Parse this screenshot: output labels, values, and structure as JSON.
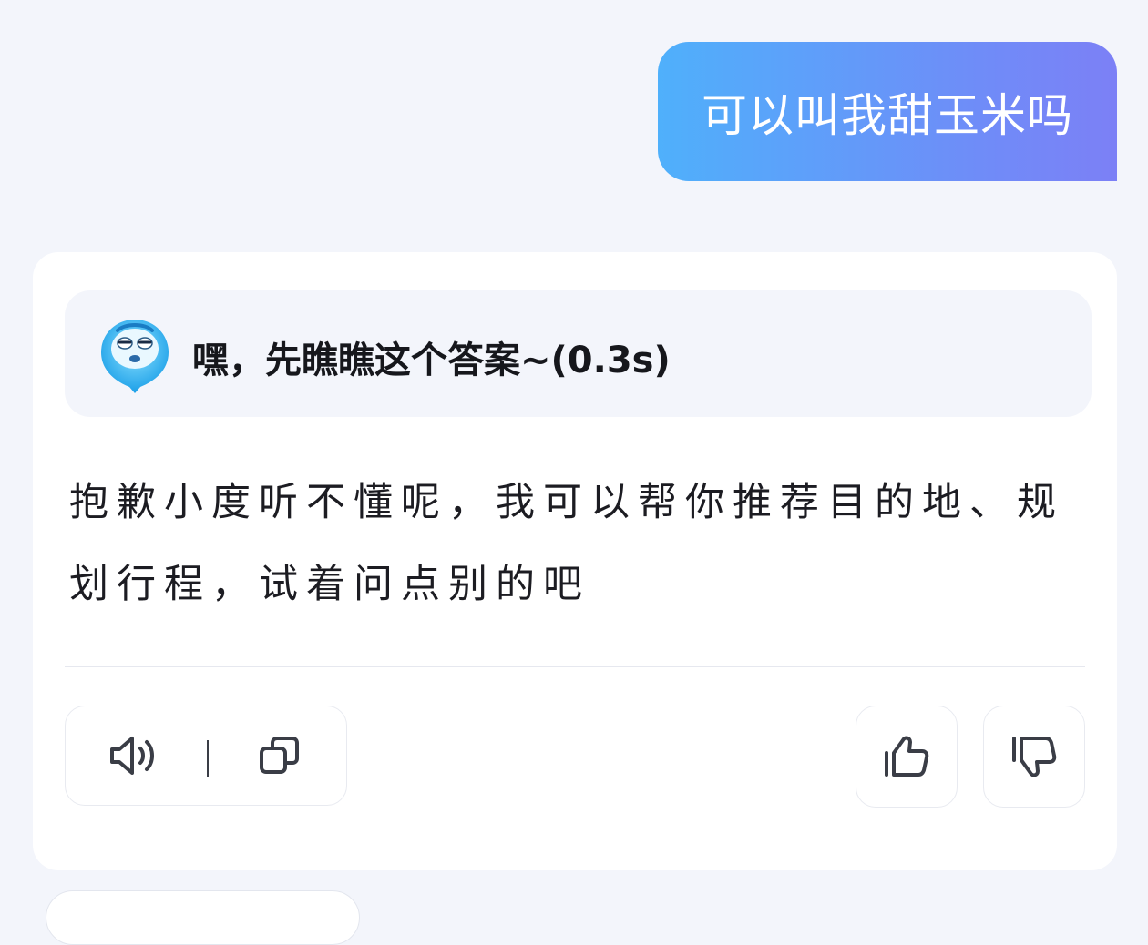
{
  "user_message": {
    "text": "可以叫我甜玉米吗"
  },
  "reply": {
    "status_text": "嘿，先瞧瞧这个答案~(0.3s)",
    "answer_text": "抱歉小度听不懂呢，我可以帮你推荐目的地、规划行程，试着问点别的吧"
  },
  "actions": {
    "speak_icon": "speaker-icon",
    "copy_icon": "copy-icon",
    "like_icon": "thumbs-up-icon",
    "dislike_icon": "thumbs-down-icon"
  },
  "colors": {
    "page_background": "#f3f5fb",
    "bubble_gradient_start": "#4fb0fb",
    "bubble_gradient_end": "#7c80f6",
    "icon_color": "#3a3d46"
  }
}
